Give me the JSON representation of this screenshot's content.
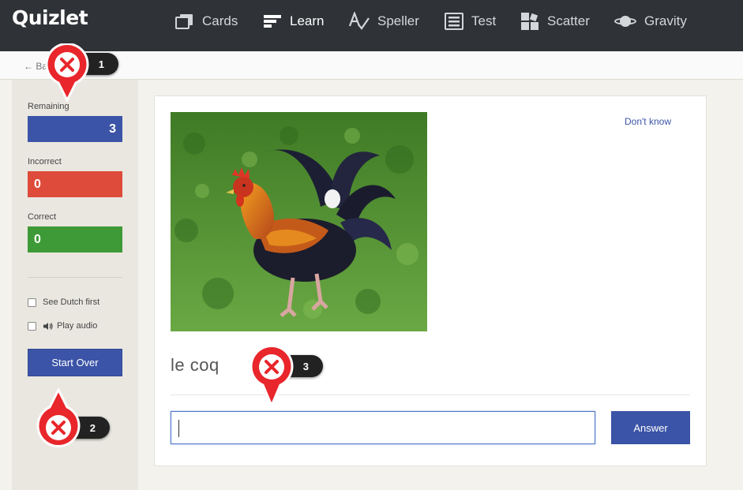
{
  "app": {
    "logo": "Quizlet"
  },
  "nav": [
    {
      "id": "cards",
      "label": "Cards",
      "icon": "cards-icon"
    },
    {
      "id": "learn",
      "label": "Learn",
      "icon": "learn-icon",
      "active": true
    },
    {
      "id": "speller",
      "label": "Speller",
      "icon": "speller-icon"
    },
    {
      "id": "test",
      "label": "Test",
      "icon": "test-icon"
    },
    {
      "id": "scatter",
      "label": "Scatter",
      "icon": "scatter-icon"
    },
    {
      "id": "gravity",
      "label": "Gravity",
      "icon": "gravity-icon"
    }
  ],
  "backbar": {
    "back_label": "← Ba"
  },
  "sidebar": {
    "remaining_label": "Remaining",
    "remaining_value": "3",
    "incorrect_label": "Incorrect",
    "incorrect_value": "0",
    "correct_label": "Correct",
    "correct_value": "0",
    "see_first_label": "See Dutch first",
    "play_audio_label": "Play audio",
    "start_over_label": "Start Over"
  },
  "card": {
    "dont_know_label": "Don't know",
    "term": "le coq",
    "answer_value": "",
    "answer_button": "Answer"
  },
  "markers": [
    {
      "number": "1"
    },
    {
      "number": "2"
    },
    {
      "number": "3"
    }
  ],
  "colors": {
    "topbar": "#2f3337",
    "accent_blue": "#3b54a7",
    "incorrect_red": "#de4b3a",
    "correct_green": "#3e9a37",
    "marker_red": "#e8262b"
  }
}
